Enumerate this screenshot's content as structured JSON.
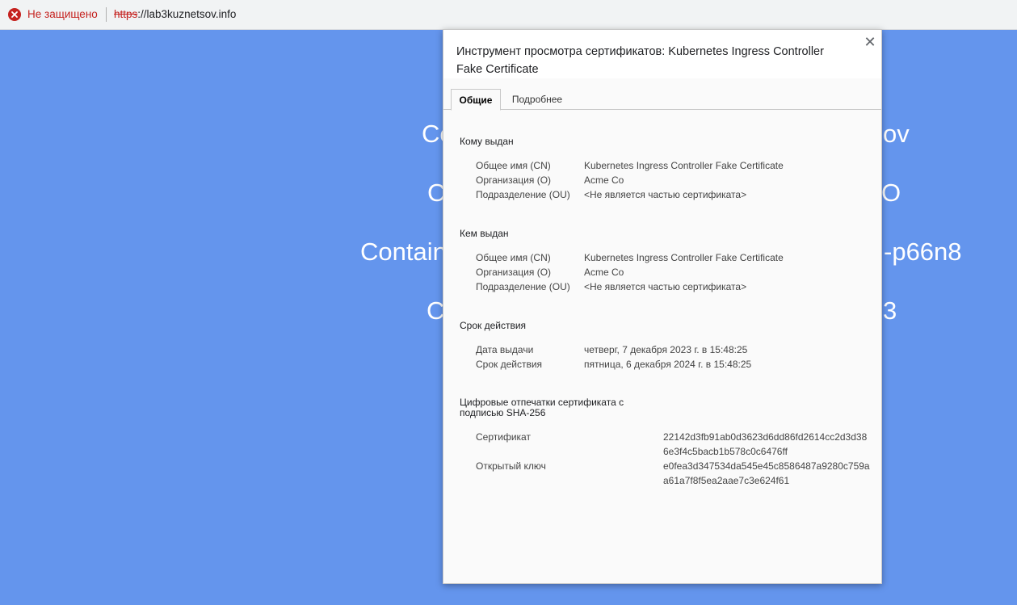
{
  "address_bar": {
    "security_label": "Не защищено",
    "url_scheme": "https",
    "url_rest": "://lab3kuznetsov.info"
  },
  "background_page": {
    "line1_left": "Co",
    "line1_right": "ov",
    "line2_left": "C",
    "line2_right": "O",
    "line3_left": "Contain",
    "line3_right": "-p66n8",
    "line4_left": "C",
    "line4_right": "3"
  },
  "dialog": {
    "title": "Инструмент просмотра сертификатов: Kubernetes Ingress Controller Fake Certificate",
    "close_glyph": "✕",
    "tabs": [
      {
        "label": "Общие"
      },
      {
        "label": "Подробнее"
      }
    ],
    "issued_to": {
      "heading": "Кому выдан",
      "rows": [
        {
          "label": "Общее имя (CN)",
          "value": "Kubernetes Ingress Controller Fake Certificate"
        },
        {
          "label": "Организация (O)",
          "value": "Acme Co"
        },
        {
          "label": "Подразделение (OU)",
          "value": "<Не является частью сертификата>"
        }
      ]
    },
    "issued_by": {
      "heading": "Кем выдан",
      "rows": [
        {
          "label": "Общее имя (CN)",
          "value": "Kubernetes Ingress Controller Fake Certificate"
        },
        {
          "label": "Организация (O)",
          "value": "Acme Co"
        },
        {
          "label": "Подразделение (OU)",
          "value": "<Не является частью сертификата>"
        }
      ]
    },
    "validity": {
      "heading": "Срок действия",
      "rows": [
        {
          "label": "Дата выдачи",
          "value": "четверг, 7 декабря 2023 г. в 15:48:25"
        },
        {
          "label": "Срок действия",
          "value": "пятница, 6 декабря 2024 г. в 15:48:25"
        }
      ]
    },
    "fingerprints": {
      "heading": "Цифровые отпечатки сертификата с подписью SHA-256",
      "rows": [
        {
          "label": "Сертификат",
          "value": "22142d3fb91ab0d3623d6dd86fd2614cc2d3d386e3f4c5bacb1b578c0c6476ff"
        },
        {
          "label": "Открытый ключ",
          "value": "e0fea3d347534da545e45c8586487a9280c759aa61a7f8f5ea2aae7c3e624f61"
        }
      ]
    }
  },
  "colors": {
    "page_background": "#6495ed",
    "security_red": "#c5221f"
  },
  "icons": {
    "security": "error-circle-icon",
    "close": "close-icon"
  }
}
